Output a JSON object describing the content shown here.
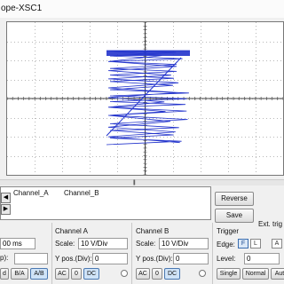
{
  "window": {
    "title": "ope-XSC1"
  },
  "cursor_table": {
    "col_a": "Channel_A",
    "col_b": "Channel_B"
  },
  "buttons": {
    "reverse": "Reverse",
    "save": "Save",
    "ext_trig": "Ext. trig"
  },
  "timebase": {
    "value": "00 ms",
    "partial_label": "p):",
    "mode_buttons": [
      "d",
      "B/A",
      "A/B"
    ]
  },
  "channel_a": {
    "title": "Channel A",
    "scale_label": "Scale:",
    "scale_value": "10  V/Div",
    "ypos_label": "Y pos.(Div):",
    "ypos_value": "0",
    "coupling": [
      "AC",
      "0",
      "DC"
    ]
  },
  "channel_b": {
    "title": "Channel B",
    "scale_label": "Scale:",
    "scale_value": "10  V/Div",
    "ypos_label": "Y pos.(Div):",
    "ypos_value": "0",
    "coupling": [
      "AC",
      "0",
      "DC"
    ]
  },
  "trigger": {
    "title": "Trigger",
    "edge_label": "Edge:",
    "edge_rising": "F",
    "edge_falling": "L",
    "edge_a": "A",
    "level_label": "Level:",
    "level_value": "0",
    "modes": [
      "Single",
      "Normal",
      "Aut"
    ]
  },
  "colors": {
    "trace": "#2233cc",
    "grid": "#b8b8b8"
  }
}
